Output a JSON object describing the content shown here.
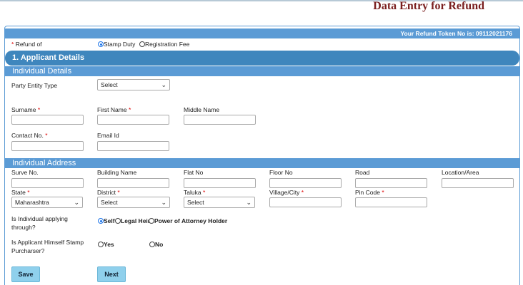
{
  "page_title": "Data Entry for Refund",
  "token_text": "Your Refund Token No is: 09112021176",
  "refund_of": {
    "label": "Refund of",
    "options": [
      "Stamp Duty",
      "Registration Fee"
    ],
    "selected": "Stamp Duty"
  },
  "section1_title": "1. Applicant Details",
  "individual_details": {
    "header": "Individual Details",
    "party_entity_type_label": "Party Entity Type",
    "party_entity_type_value": "Select",
    "surname_label": "Surname",
    "first_name_label": "First Name",
    "middle_name_label": "Middle Name",
    "contact_label": "Contact No.",
    "email_label": "Email Id"
  },
  "individual_address": {
    "header": "Individual Address",
    "survey_label": "Surve No.",
    "building_label": "Building Name",
    "flat_label": "Flat No",
    "floor_label": "Floor No",
    "road_label": "Road",
    "location_label": "Location/Area",
    "state_label": "State",
    "state_value": "Maharashtra",
    "district_label": "District",
    "district_value": "Select",
    "taluka_label": "Taluka",
    "taluka_value": "Select",
    "village_label": "Village/City",
    "pincode_label": "Pin Code"
  },
  "applying_through": {
    "label_line1": "Is Individual applying",
    "label_line2": "through?",
    "options": [
      "Self",
      "Legal Heir",
      "Power of Attorney Holder"
    ],
    "selected": "Self"
  },
  "stamp_purchaser": {
    "label_line1": "Is Applicant Himself Stamp",
    "label_line2": "Purcharser?",
    "options": [
      "Yes",
      "No"
    ]
  },
  "buttons": {
    "save": "Save",
    "next": "Next"
  },
  "required_marker": "*"
}
